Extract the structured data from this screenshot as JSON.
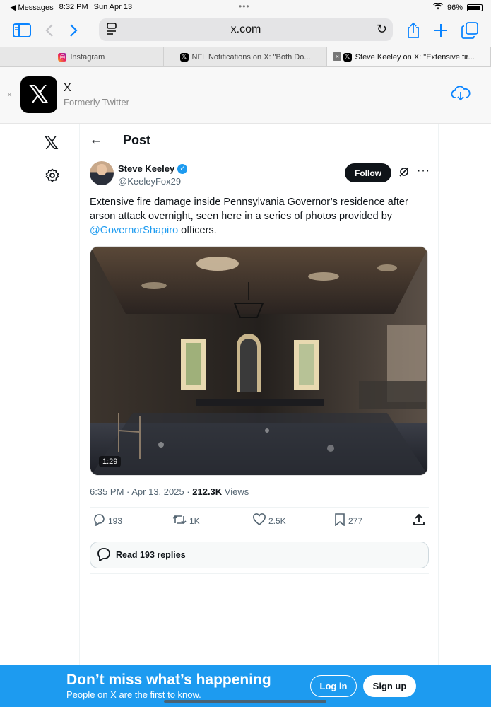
{
  "status_bar": {
    "back_app": "◀ Messages",
    "time": "8:32 PM",
    "date": "Sun Apr 13",
    "battery": "96%"
  },
  "browser": {
    "url": "x.com",
    "tabs": [
      {
        "title": "Instagram"
      },
      {
        "title": "NFL Notifications on X: \"Both Do..."
      },
      {
        "title": "Steve Keeley on X: \"Extensive fir..."
      }
    ]
  },
  "app_banner": {
    "name": "X",
    "subtitle": "Formerly Twitter",
    "close": "×"
  },
  "post_header": {
    "title": "Post",
    "back": "←"
  },
  "author": {
    "name": "Steve Keeley",
    "handle": "@KeeleyFox29",
    "follow_label": "Follow"
  },
  "tweet": {
    "text_before": "Extensive fire damage inside Pennsylvania Governor’s residence after arson attack overnight, seen here in a series of photos provided by ",
    "mention": "@GovernorShapiro",
    "text_after": " officers.",
    "video_duration": "1:29",
    "timestamp": "6:35 PM · Apr 13, 2025 · ",
    "views_count": "212.3K",
    "views_label": " Views"
  },
  "actions": {
    "replies": "193",
    "reposts": "1K",
    "likes": "2.5K",
    "bookmarks": "277"
  },
  "replies_button": {
    "label": "Read 193 replies"
  },
  "bottom_banner": {
    "headline": "Don’t miss what’s happening",
    "sub": "People on X are the first to know.",
    "login": "Log in",
    "signup": "Sign up"
  },
  "colors": {
    "brand_blue": "#1d9bf0",
    "safari_blue": "#0a84ff",
    "text": "#0f1419",
    "muted": "#536471"
  },
  "icons": [
    "sidebar-icon",
    "back-arrow-icon",
    "forward-arrow-icon",
    "reader-icon",
    "reload-icon",
    "share-icon",
    "plus-icon",
    "tabs-icon",
    "download-icon",
    "x-logo-icon",
    "gear-icon",
    "verified-icon",
    "grok-icon",
    "more-icon",
    "reply-icon",
    "repost-icon",
    "like-icon",
    "bookmark-icon",
    "upload-icon"
  ]
}
